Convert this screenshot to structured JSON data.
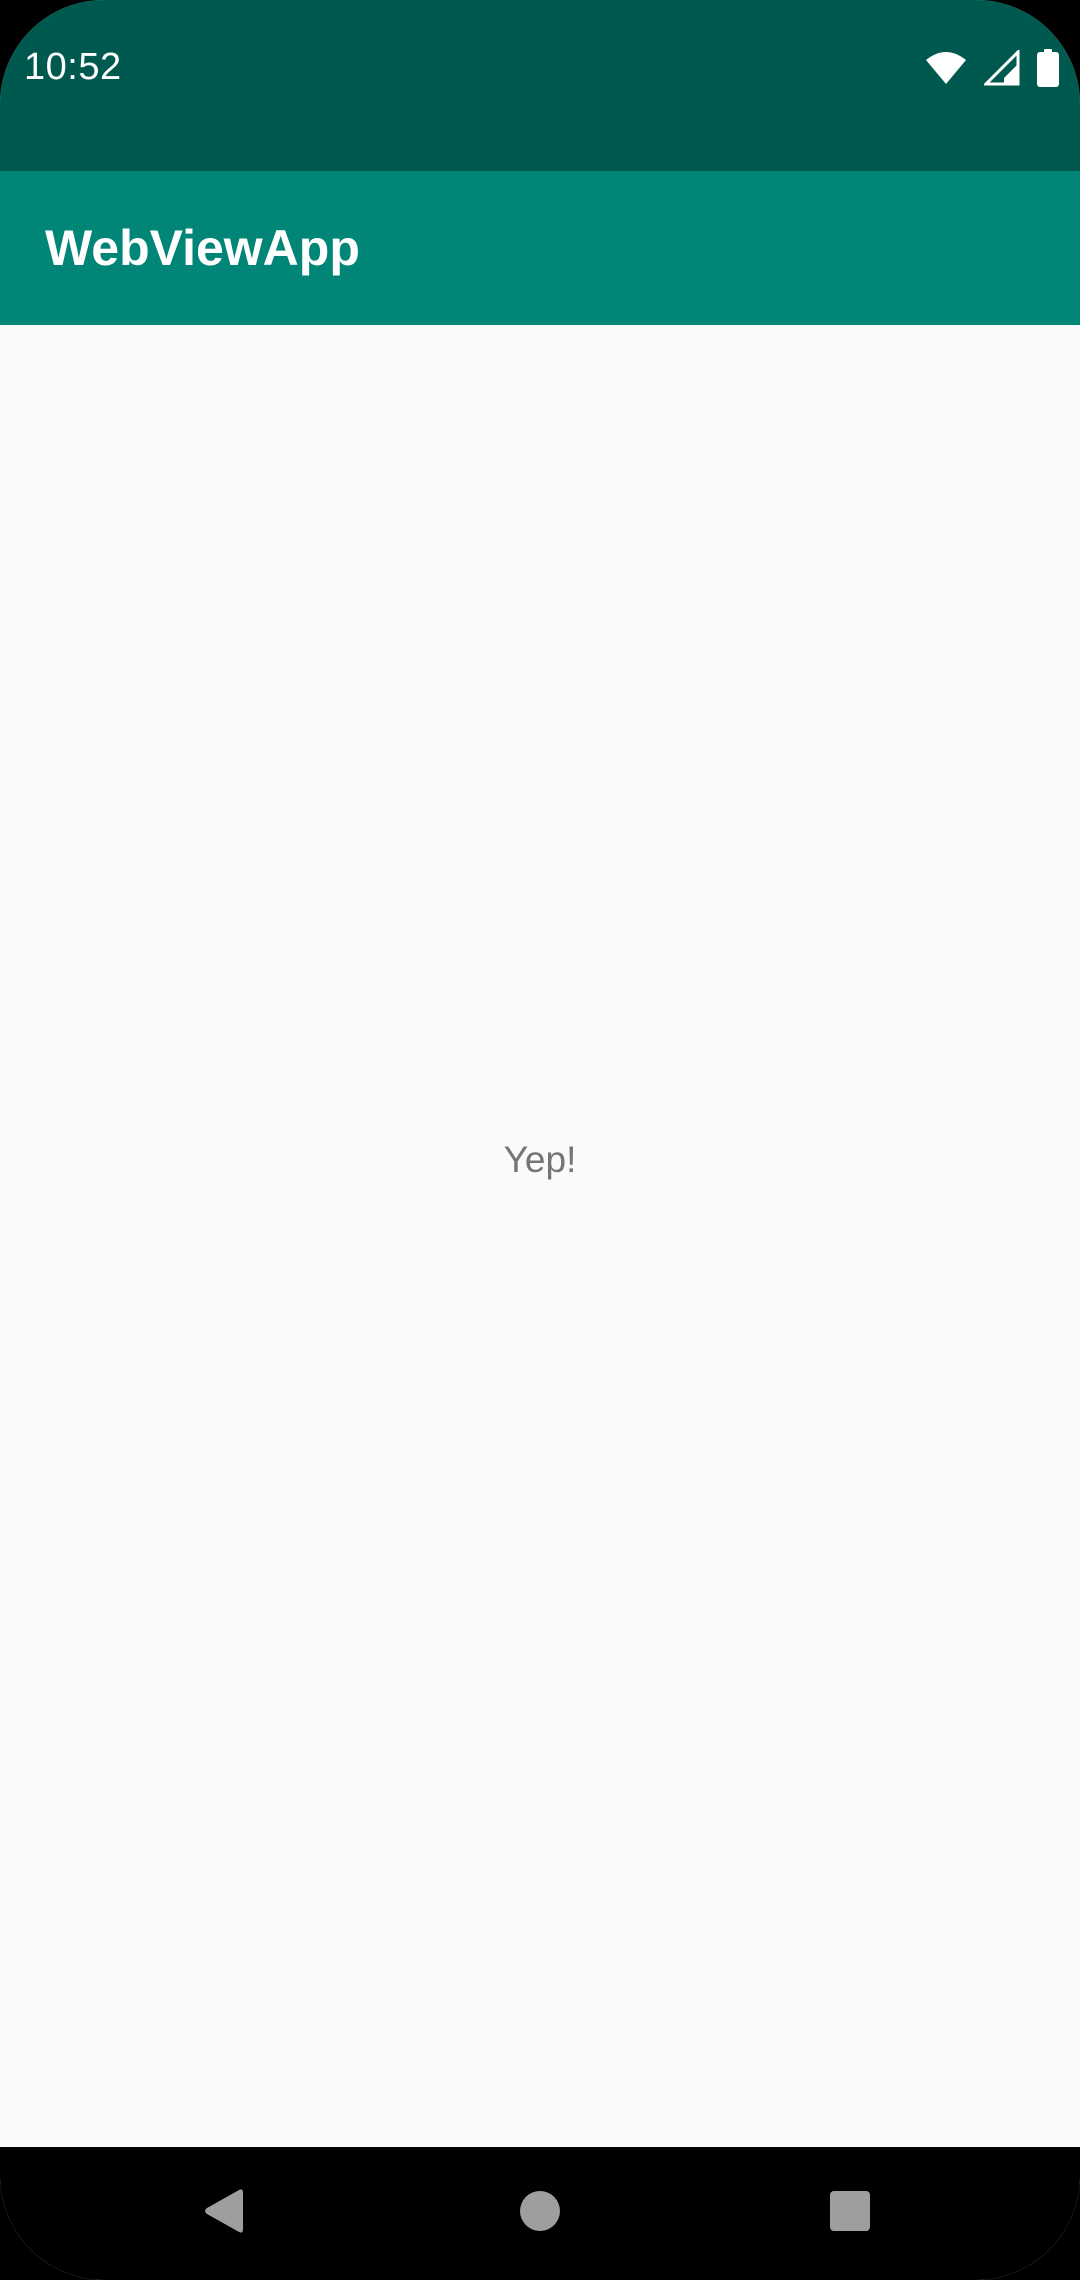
{
  "status_bar": {
    "time": "10:52",
    "icons": [
      "wifi-icon",
      "signal-icon",
      "battery-icon"
    ],
    "background": "#00594e"
  },
  "app_bar": {
    "title": "WebViewApp",
    "background": "#008577"
  },
  "content": {
    "message": "Yep!",
    "background": "#fafafa",
    "text_color": "#757575"
  },
  "nav_bar": {
    "buttons": [
      "back-icon",
      "home-icon",
      "recents-icon"
    ],
    "icon_color": "#9e9e9e"
  }
}
